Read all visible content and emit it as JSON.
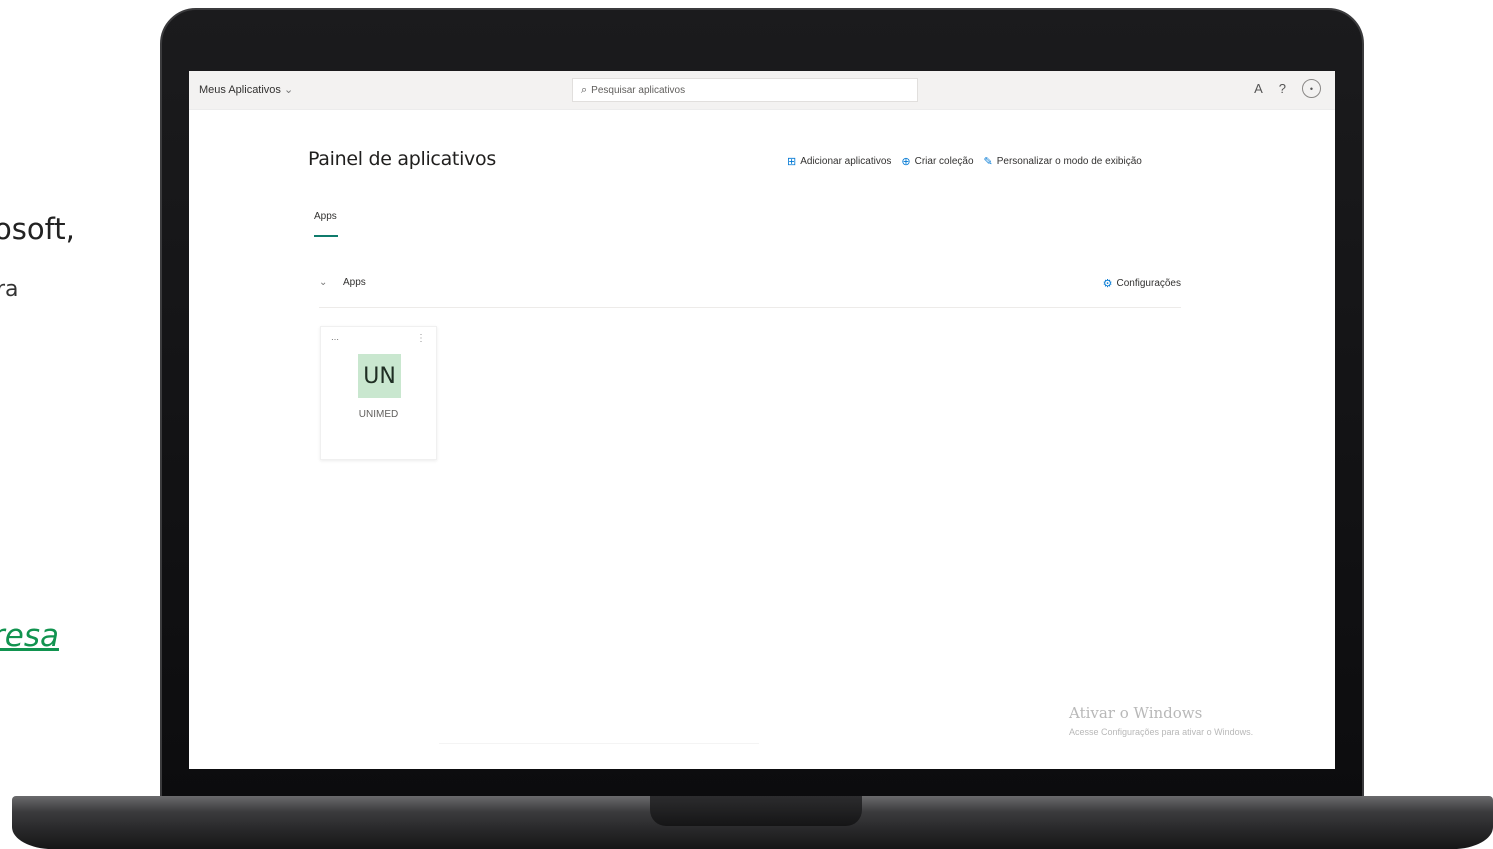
{
  "slide": {
    "line1": "osoft,",
    "line2": "ra",
    "line3": "resa"
  },
  "topbar": {
    "app_title": "Meus Aplicativos",
    "app_title_chevron": "⌄",
    "search_placeholder": "Pesquisar aplicativos",
    "search_icon": "search-icon",
    "icons": [
      "text-icon",
      "help-icon",
      "account-icon"
    ],
    "text_icon_glyph": "A",
    "help_glyph": "?",
    "avatar_glyph": "•"
  },
  "main": {
    "page_title": "Painel de aplicativos",
    "actions": [
      {
        "label": "Adicionar aplicativos",
        "icon": "add-app-icon",
        "glyph": "⊞"
      },
      {
        "label": "Criar coleção",
        "icon": "add-collection-icon",
        "glyph": "⊕"
      },
      {
        "label": "Personalizar o modo de exibição",
        "icon": "pen-icon",
        "glyph": "✎"
      }
    ],
    "tabs": [
      {
        "label": "Apps"
      }
    ],
    "group": {
      "chevron": "⌄",
      "name": "Apps",
      "settings_label": "Configurações",
      "settings_glyph": "⚙"
    },
    "tiles": [
      {
        "initials": "UN",
        "label": "UNIMED",
        "badge_color": "#c9e7cf",
        "menu_glyph": "⋯",
        "more_glyph": "⋮"
      }
    ]
  },
  "watermark": {
    "title": "Ativar o Windows",
    "subtitle": "Acesse Configurações para ativar o Windows."
  },
  "colors": {
    "accent": "#0078d4",
    "tab_underline": "#0f7b6c",
    "link_green": "#11934f"
  }
}
